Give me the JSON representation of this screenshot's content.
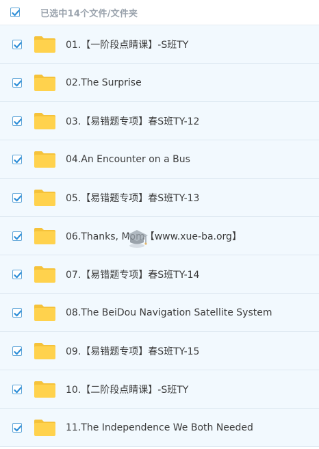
{
  "header": {
    "select_all_checked": true,
    "selection_text": "已选中14个文件/文件夹"
  },
  "files": [
    {
      "name": "01.【一阶段点睛课】-S班TY",
      "checked": true
    },
    {
      "name": "02.The Surprise",
      "checked": true
    },
    {
      "name": "03.【易错题专项】春S班TY-12",
      "checked": true
    },
    {
      "name": "04.An Encounter on a Bus",
      "checked": true
    },
    {
      "name": "05.【易错题专项】春S班TY-13",
      "checked": true
    },
    {
      "name": "06.Thanks, Mom【www.xue-ba.org】",
      "checked": true
    },
    {
      "name": "07.【易错题专项】春S班TY-14",
      "checked": true
    },
    {
      "name": "08.The BeiDou Navigation Satellite System",
      "checked": true
    },
    {
      "name": "09.【易错题专项】春S班TY-15",
      "checked": true
    },
    {
      "name": "10.【二阶段点睛课】-S班TY",
      "checked": true
    },
    {
      "name": "11.The Independence We Both Needed",
      "checked": true
    }
  ],
  "colors": {
    "checkbox_border": "#5ea5d8",
    "checkmark": "#2f8fd8",
    "folder_body": "#ffd24d",
    "folder_tab": "#f5c23a",
    "row_bg": "#f2f9fe"
  },
  "icons": {
    "checkbox": "checkmark-icon",
    "folder": "folder-icon",
    "watermark": "graduation-cap-icon"
  }
}
